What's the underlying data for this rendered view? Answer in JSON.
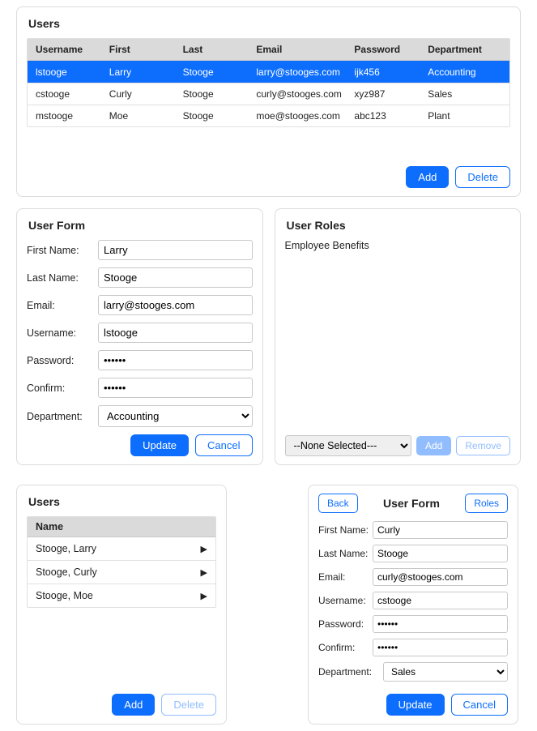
{
  "users_grid": {
    "title": "Users",
    "columns": [
      "Username",
      "First",
      "Last",
      "Email",
      "Password",
      "Department"
    ],
    "rows": [
      {
        "cells": [
          "lstooge",
          "Larry",
          "Stooge",
          "larry@stooges.com",
          "ijk456",
          "Accounting"
        ],
        "selected": true
      },
      {
        "cells": [
          "cstooge",
          "Curly",
          "Stooge",
          "curly@stooges.com",
          "xyz987",
          "Sales"
        ],
        "selected": false
      },
      {
        "cells": [
          "mstooge",
          "Moe",
          "Stooge",
          "moe@stooges.com",
          "abc123",
          "Plant"
        ],
        "selected": false
      }
    ],
    "add_label": "Add",
    "delete_label": "Delete"
  },
  "user_form": {
    "title": "User Form",
    "first_name_label": "First Name:",
    "first_name_value": "Larry",
    "last_name_label": "Last Name:",
    "last_name_value": "Stooge",
    "email_label": "Email:",
    "email_value": "larry@stooges.com",
    "username_label": "Username:",
    "username_value": "lstooge",
    "password_label": "Password:",
    "password_value": "••••••",
    "confirm_label": "Confirm:",
    "confirm_value": "••••••",
    "department_label": "Department:",
    "department_value": "Accounting",
    "update_label": "Update",
    "cancel_label": "Cancel"
  },
  "user_roles": {
    "title": "User Roles",
    "items": [
      "Employee Benefits"
    ],
    "selector_value": "--None Selected---",
    "add_label": "Add",
    "remove_label": "Remove"
  },
  "mini_users": {
    "title": "Users",
    "column": "Name",
    "rows": [
      "Stooge, Larry",
      "Stooge, Curly",
      "Stooge, Moe"
    ],
    "add_label": "Add",
    "delete_label": "Delete"
  },
  "detail_form": {
    "back_label": "Back",
    "title": "User Form",
    "roles_label": "Roles",
    "first_name_label": "First Name:",
    "first_name_value": "Curly",
    "last_name_label": "Last Name:",
    "last_name_value": "Stooge",
    "email_label": "Email:",
    "email_value": "curly@stooges.com",
    "username_label": "Username:",
    "username_value": "cstooge",
    "password_label": "Password:",
    "password_value": "••••••",
    "confirm_label": "Confirm:",
    "confirm_value": "••••••",
    "department_label": "Department:",
    "department_value": "Sales",
    "update_label": "Update",
    "cancel_label": "Cancel"
  }
}
